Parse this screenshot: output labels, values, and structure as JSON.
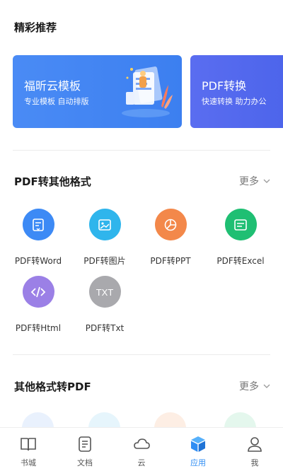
{
  "featured": {
    "title": "精彩推荐",
    "banners": [
      {
        "title": "福昕云模板",
        "subtitle": "专业模板  自动排版"
      },
      {
        "title": "PDF转换",
        "subtitle": "快速转换  助力办公"
      }
    ]
  },
  "pdf_to_other": {
    "title": "PDF转其他格式",
    "more_label": "更多",
    "items": [
      {
        "label": "PDF转Word",
        "icon": "word-doc-icon",
        "color": "#3d8af5"
      },
      {
        "label": "PDF转图片",
        "icon": "image-icon",
        "color": "#2fb5ec"
      },
      {
        "label": "PDF转PPT",
        "icon": "pie-chart-icon",
        "color": "#f3884a"
      },
      {
        "label": "PDF转Excel",
        "icon": "sheet-icon",
        "color": "#1fbf73"
      },
      {
        "label": "PDF转Html",
        "icon": "code-icon",
        "color": "#9b80e6"
      },
      {
        "label": "PDF转Txt",
        "icon": "txt-icon",
        "color": "#a9a9ad"
      }
    ]
  },
  "other_to_pdf": {
    "title": "其他格式转PDF",
    "more_label": "更多"
  },
  "tabbar": {
    "items": [
      {
        "label": "书城",
        "icon": "book-icon"
      },
      {
        "label": "文档",
        "icon": "document-icon"
      },
      {
        "label": "云",
        "icon": "cloud-icon"
      },
      {
        "label": "应用",
        "icon": "cube-icon"
      },
      {
        "label": "我",
        "icon": "user-icon"
      }
    ],
    "active_index": 3,
    "active_color": "#2f8df3"
  }
}
